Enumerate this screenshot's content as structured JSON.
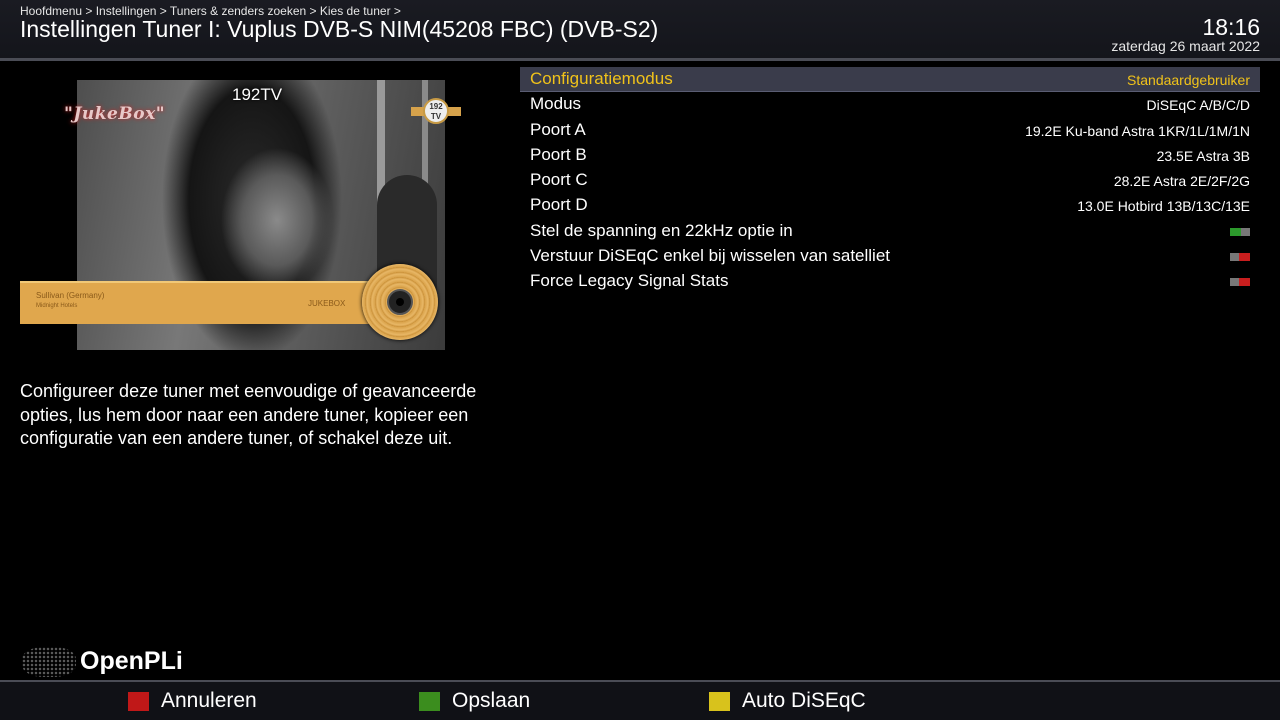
{
  "header": {
    "breadcrumb": "Hoofdmenu > Instellingen > Tuners & zenders zoeken > Kies de tuner >",
    "title": "Instellingen Tuner I: Vuplus DVB-S NIM(45208 FBC) (DVB-S2)",
    "time": "18:16",
    "date": "zaterdag 26 maart 2022"
  },
  "preview": {
    "channel": "192TV",
    "jukebox_logo": "\"JukeBox\"",
    "badge_text": "192 TV",
    "ticker_line1": "Sullivan (Germany)",
    "ticker_line2": "Midnight Hotels",
    "ticker_right": "JUKEBOX"
  },
  "description": "Configureer deze tuner met eenvoudige of geavanceerde opties, lus hem door naar een andere tuner, kopieer een configuratie van een andere tuner, of schakel deze uit.",
  "logo": {
    "text": "OpenPLi"
  },
  "config": {
    "rows": [
      {
        "label": "Configuratiemodus",
        "value": "Standaardgebruiker"
      },
      {
        "label": "Modus",
        "value": "DiSEqC A/B/C/D"
      },
      {
        "label": "Poort A",
        "value": "19.2E Ku-band Astra 1KR/1L/1M/1N"
      },
      {
        "label": "Poort B",
        "value": "23.5E Astra 3B"
      },
      {
        "label": "Poort C",
        "value": "28.2E Astra 2E/2F/2G"
      },
      {
        "label": "Poort D",
        "value": "13.0E Hotbird 13B/13C/13E"
      },
      {
        "label": "Stel de spanning en 22kHz optie in",
        "toggle": "on"
      },
      {
        "label": "Verstuur DiSEqC enkel bij wisselen van satelliet",
        "toggle": "off"
      },
      {
        "label": "Force Legacy Signal Stats",
        "toggle": "off"
      }
    ],
    "selected_index": 0,
    "colors": {
      "selected_text": "#f0c21a",
      "selected_bg": "#3a3c4b",
      "toggle_on": "#2c9a2c",
      "toggle_off": "#c81e1e"
    }
  },
  "footer": {
    "red_label": "Annuleren",
    "green_label": "Opslaan",
    "yellow_label": "Auto DiSEqC",
    "colors": {
      "red": "#c01818",
      "green": "#3b8d1e",
      "yellow": "#d8c21c"
    }
  }
}
